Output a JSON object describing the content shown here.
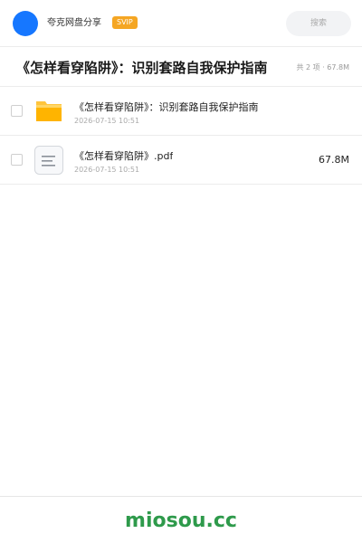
{
  "header": {
    "user_name": "夸克网盘分享",
    "badge": "SVIP",
    "search_placeholder": "搜索"
  },
  "folder": {
    "title": "《怎样看穿陷阱》：识别套路自我保护指南",
    "summary": "共 2 项 · 67.8M"
  },
  "files": [
    {
      "name": "《怎样看穿陷阱》：识别套路自我保护指南",
      "date": "2026-07-15 10:51",
      "size": "",
      "icon": "folder-icon"
    },
    {
      "name": "《怎样看穿陷阱》.pdf",
      "date": "2026-07-15 10:51",
      "size": "67.8M",
      "icon": "document-icon"
    }
  ],
  "footer": {
    "watermark": "miosou.cc"
  },
  "colors": {
    "accent": "#1677ff",
    "svip": "#f5a623",
    "folder": "#ffc53d",
    "watermark": "#2e9a4b"
  }
}
